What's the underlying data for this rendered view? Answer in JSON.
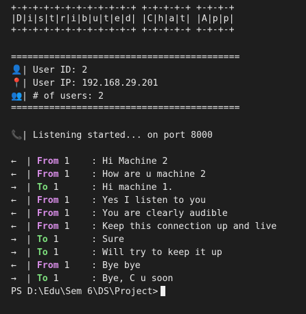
{
  "banner": {
    "border": "+-+-+-+-+-+-+-+-+-+-+-+ +-+-+-+-+ +-+-+-+",
    "title": "|D|i|s|t|r|i|b|u|t|e|d| |C|h|a|t| |A|p|p|"
  },
  "info": {
    "rule": "==========================================",
    "user_id": "User ID: 2",
    "user_ip": "User IP: 192.168.29.201",
    "num_users": "# of users: 2"
  },
  "status": {
    "listening": "Listening started... on port 8000"
  },
  "messages": [
    {
      "dir": "From",
      "peer": "1",
      "text": ": Hi Machine 2",
      "arrow": "←"
    },
    {
      "dir": "From",
      "peer": "1",
      "text": ": How are u machine 2",
      "arrow": "←"
    },
    {
      "dir": "To",
      "peer": "1",
      "text": ": Hi machine 1.",
      "arrow": "→"
    },
    {
      "dir": "From",
      "peer": "1",
      "text": ": Yes I listen to you",
      "arrow": "←"
    },
    {
      "dir": "From",
      "peer": "1",
      "text": ": You are clearly audible",
      "arrow": "←"
    },
    {
      "dir": "From",
      "peer": "1",
      "text": ": Keep this connection up and live",
      "arrow": "←"
    },
    {
      "dir": "To",
      "peer": "1",
      "text": ": Sure",
      "arrow": "→"
    },
    {
      "dir": "To",
      "peer": "1",
      "text": ": Will try to keep it up",
      "arrow": "→"
    },
    {
      "dir": "From",
      "peer": "1",
      "text": ": Bye bye",
      "arrow": "←"
    },
    {
      "dir": "To",
      "peer": "1",
      "text": ": Bye, C u soon",
      "arrow": "→"
    }
  ],
  "prompt": {
    "text": "PS D:\\Edu\\Sem 6\\DS\\Project>"
  },
  "colors": {
    "background": "#1e1e1e",
    "from": "#d98ee8",
    "to": "#7ee07e"
  }
}
